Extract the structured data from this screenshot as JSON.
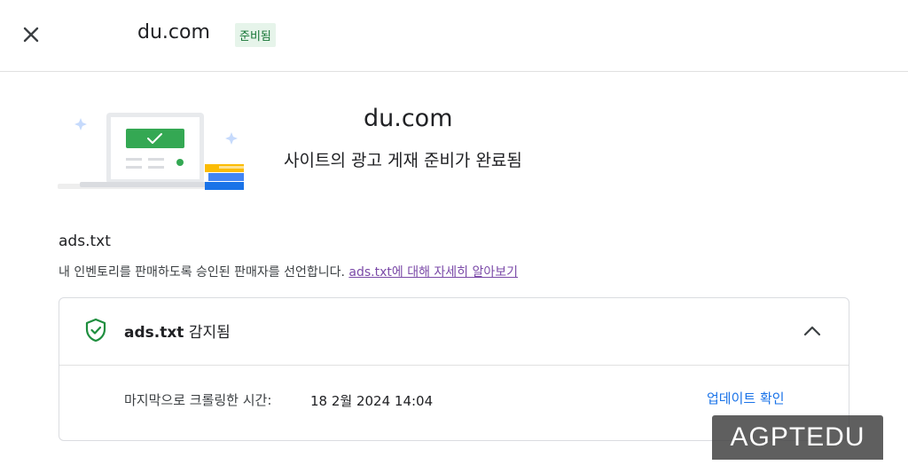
{
  "header": {
    "site_name": "du.com",
    "badge": "준비됨"
  },
  "hero": {
    "site_name": "du.com",
    "status": "사이트의 광고 게재 준비가 완료됨"
  },
  "adstxt": {
    "title": "ads.txt",
    "description": "내 인벤토리를 판매하도록 승인된 판매자를 선언합니다. ",
    "link_text": "ads.txt에 대해 자세히 알아보기",
    "card": {
      "title_bold": "ads.txt",
      "title_rest": " 감지됨",
      "crawl_label": "마지막으로 크롤링한 시간:",
      "crawl_value": "18 2월 2024 14:04",
      "update_link": "업데이트 확인"
    }
  },
  "icons": {
    "close": "close-icon",
    "shield": "shield-check-icon",
    "chevron": "chevron-up-icon"
  },
  "colors": {
    "badge_bg": "#e6f4ea",
    "badge_text": "#137333",
    "link_purple": "#7b4aa8",
    "link_blue": "#1a73e8",
    "success_green": "#34a853"
  },
  "watermark": "AGPTEDU"
}
